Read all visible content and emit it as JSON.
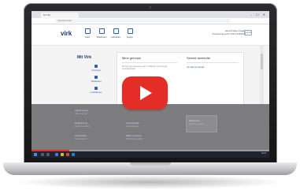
{
  "browser": {
    "tab_title": "Mi Virk",
    "url": "virk.dk/mitvirk",
    "window_controls": "– ☐ ✕"
  },
  "site": {
    "logo": "virk",
    "nav": [
      {
        "icon": "home-icon",
        "label": "Start"
      },
      {
        "icon": "grid-icon",
        "label": "Tilladelser"
      },
      {
        "icon": "mail-icon",
        "label": "Indbakke"
      },
      {
        "icon": "help-icon",
        "label": "Hjælp"
      }
    ],
    "header_right_line1": "Henrik Ravn Hagen",
    "header_right_line2": "Virksomhed A/S CVR 12345678",
    "header_button": "Log ud"
  },
  "sidebar": {
    "title": "Mit Virk",
    "links": [
      "Oversigt",
      "Tilladelser",
      "Indstillinger"
    ]
  },
  "card": {
    "left_heading": "Mine genveje",
    "right_heading": "Senest anvendte",
    "body_text": "Du har ingen genveje endnu. Tilføj dine mest brugte selvbetjeninger.",
    "right_link": "Se alle anvendte"
  },
  "dimmed_links": [
    {
      "title": "Indberetning",
      "sub": "Moms og skat"
    },
    {
      "title": "Registrering",
      "sub": "Start virksomhed"
    },
    {
      "title": "Ansættelse",
      "sub": "Medarbejdere"
    },
    {
      "title": "Arbejdsmiljø",
      "sub": "Arbejdstilsynet"
    },
    {
      "title": "Miljø og energi",
      "sub": "Udledning og affald"
    },
    {
      "title": "Fødevarer",
      "sub": "Kontrol og regler"
    }
  ],
  "taskbar": {
    "clock_time": "10:24",
    "clock_date": "12-05-2017"
  },
  "video": {
    "progress": 0.16,
    "play_color": "#e52d27"
  },
  "colors": {
    "brand": "#1a3a6b",
    "link": "#2e5fa8",
    "play": "#e52d27"
  }
}
